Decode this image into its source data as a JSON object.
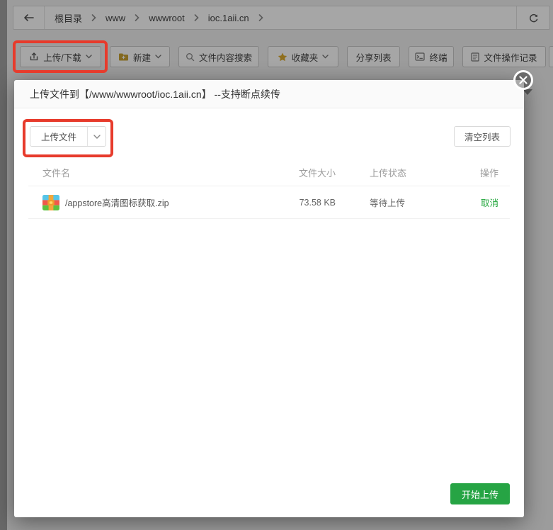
{
  "page": {
    "topbar": {
      "back_icon": "arrow-left-icon",
      "breadcrumb": [
        "根目录",
        "www",
        "wwwroot",
        "ioc.1aii.cn"
      ],
      "refresh_icon": "refresh-icon"
    },
    "toolbar": {
      "buttons": [
        {
          "label": "上传/下载",
          "icon": "upload-icon",
          "caret": true
        },
        {
          "label": "新建",
          "icon": "folder-icon",
          "caret": true
        },
        {
          "label": "文件内容搜索",
          "icon": "search-icon",
          "caret": false
        },
        {
          "label": "收藏夹",
          "icon": "star-icon",
          "caret": true
        },
        {
          "label": "分享列表",
          "icon": "",
          "caret": false
        },
        {
          "label": "终端",
          "icon": "terminal-icon",
          "caret": false
        },
        {
          "label": "文件操作记录",
          "icon": "history-icon",
          "caret": false
        }
      ]
    }
  },
  "modal": {
    "title": "上传文件到【/www/wwwroot/ioc.1aii.cn】 --支持断点续传",
    "close_icon": "close-icon",
    "upload_button": {
      "label": "上传文件",
      "caret_icon": "chevron-down-icon"
    },
    "clear_button": {
      "label": "清空列表"
    },
    "table": {
      "headers": [
        "文件名",
        "文件大小",
        "上传状态",
        "操作"
      ],
      "rows": [
        {
          "icon": "zip-file-icon",
          "name": "/appstore高清图标获取.zip",
          "size": "73.58 KB",
          "status": "等待上传",
          "action": "取消"
        }
      ]
    },
    "start_button": {
      "label": "开始上传"
    }
  },
  "colors": {
    "accent_green": "#26a444",
    "cancel_green": "#20a53a",
    "highlight_red": "#e73b2c"
  }
}
